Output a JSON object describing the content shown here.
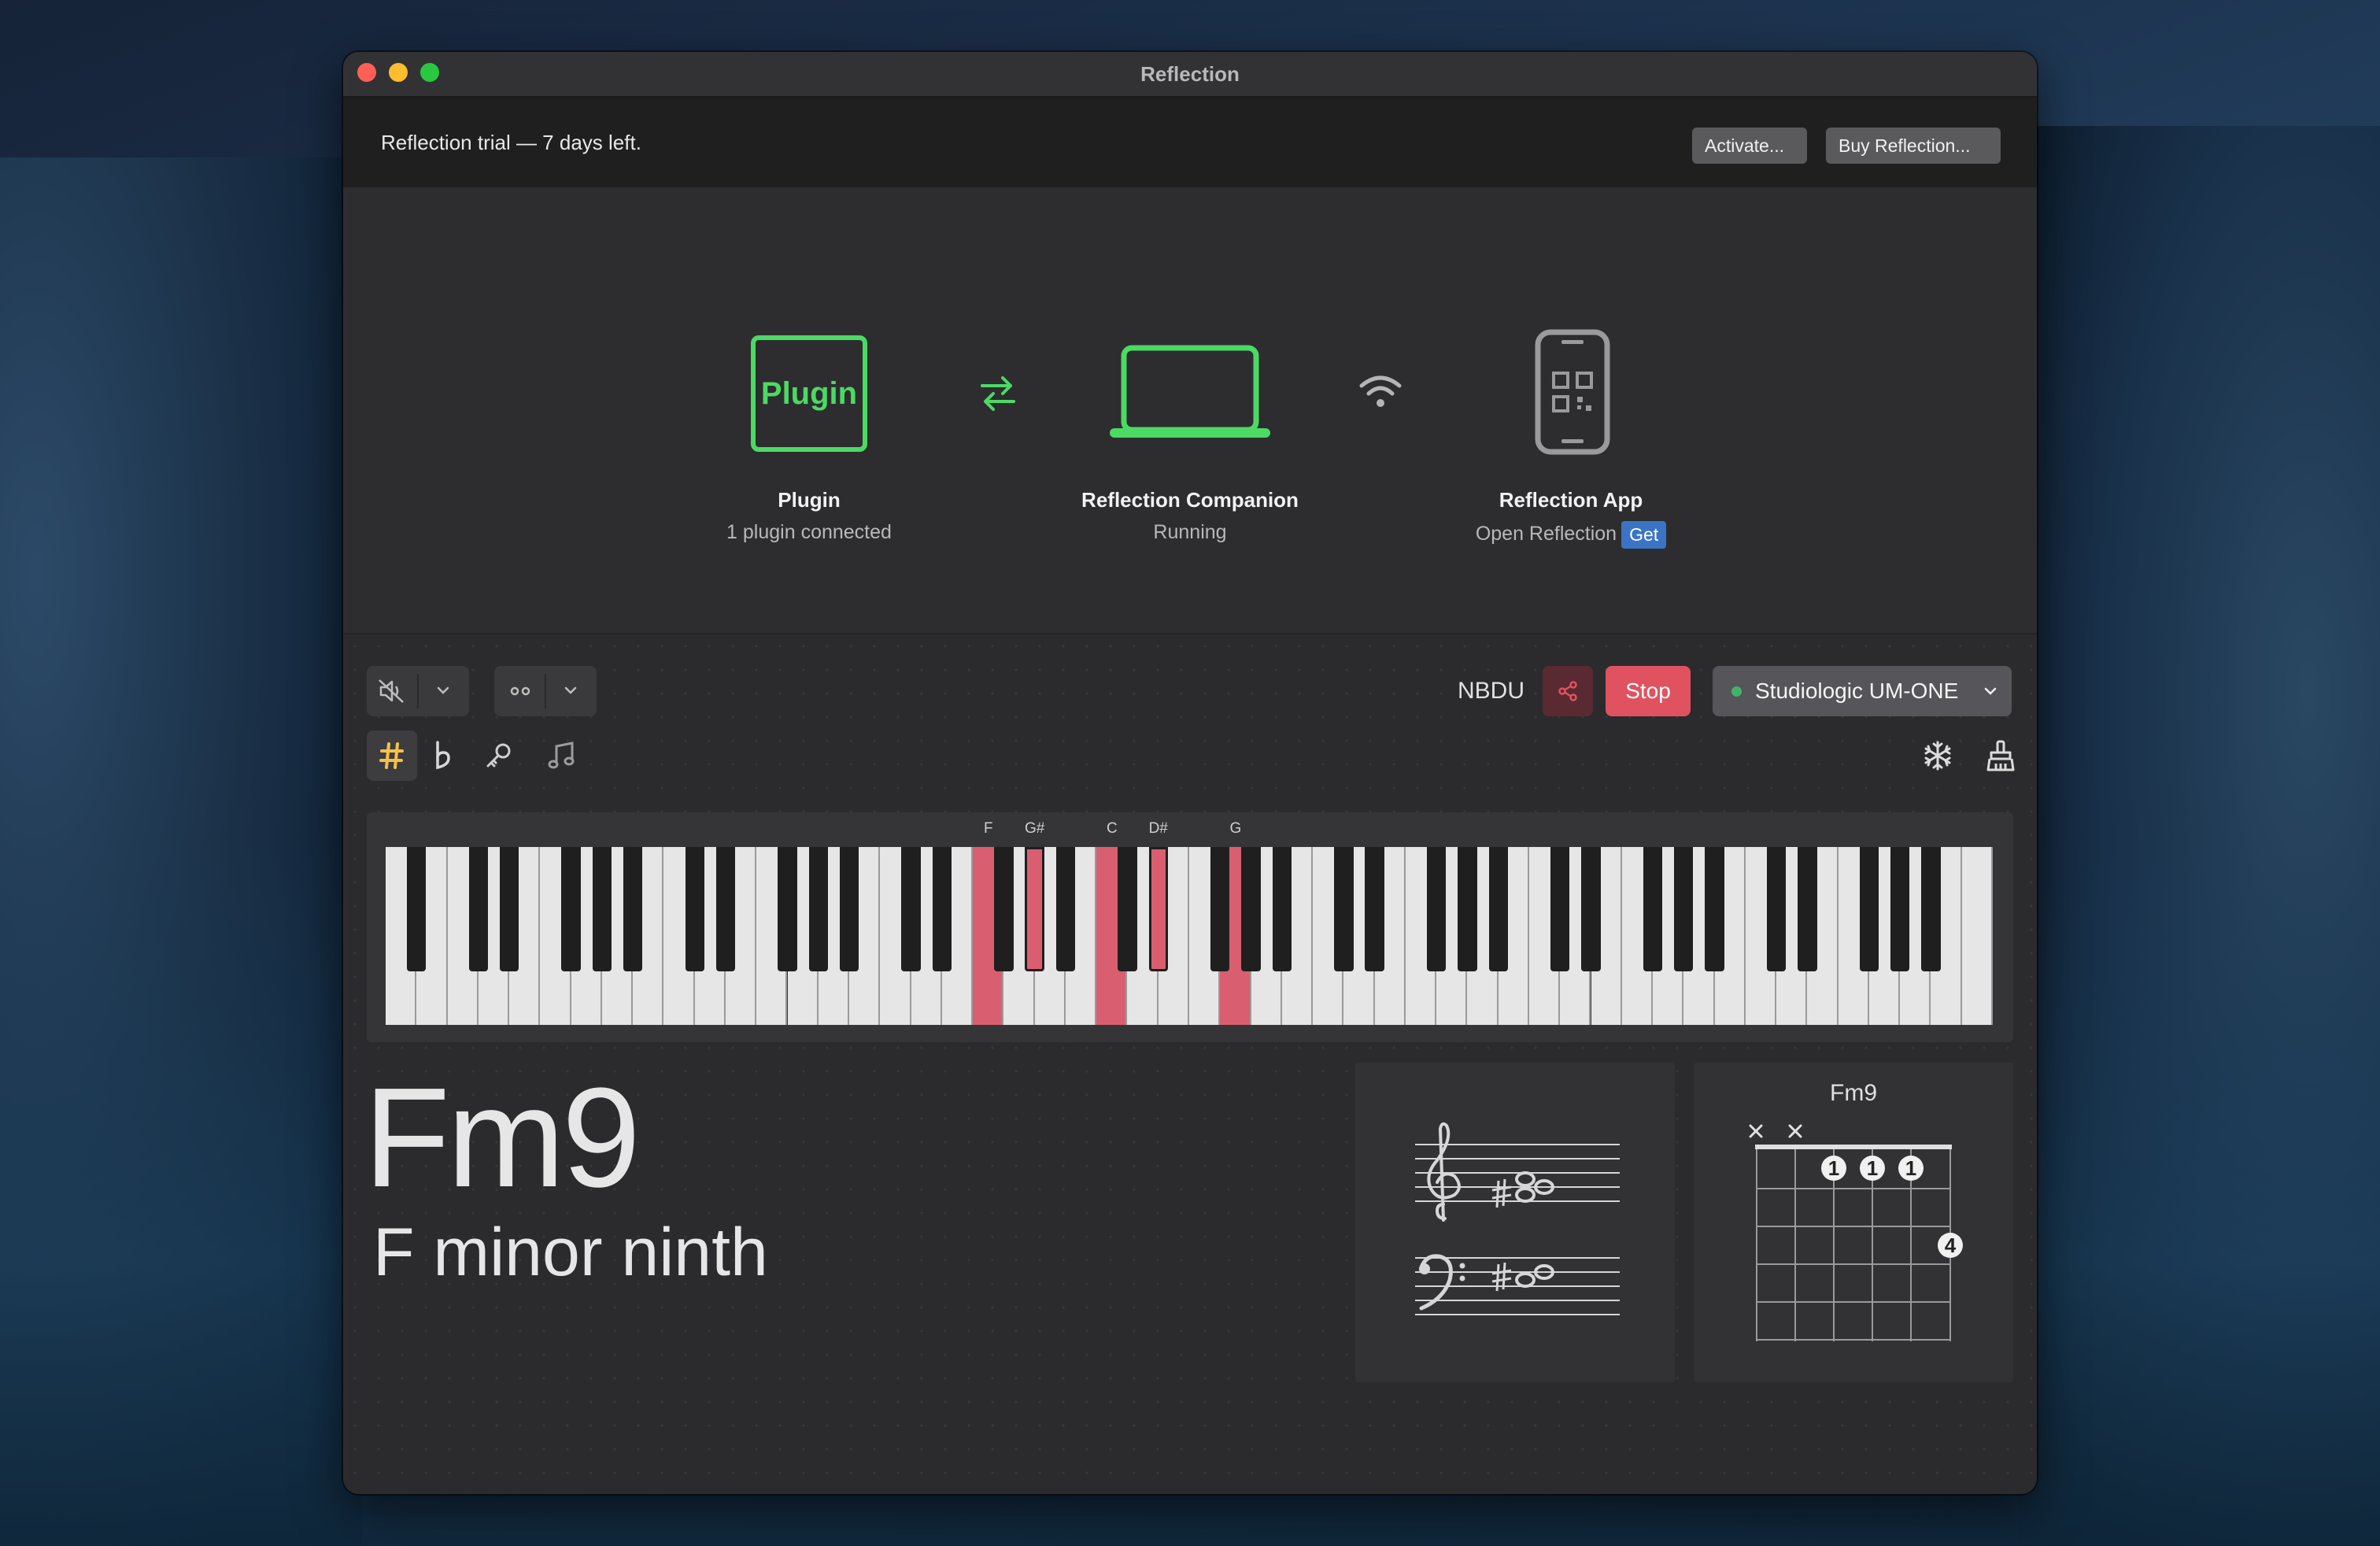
{
  "window": {
    "title": "Reflection"
  },
  "trial": {
    "message": "Reflection trial — 7 days left.",
    "activate_label": "Activate...",
    "buy_label": "Buy Reflection..."
  },
  "status": {
    "plugin": {
      "icon_text": "Plugin",
      "title": "Plugin",
      "subtitle": "1 plugin connected"
    },
    "companion": {
      "title": "Reflection Companion",
      "subtitle": "Running"
    },
    "app": {
      "title": "Reflection App",
      "subtitle": "Open Reflection",
      "get_label": "Get"
    },
    "accent_green": "#4cd964"
  },
  "toolbar": {
    "session_code": "NBDU",
    "stop_label": "Stop",
    "midi_device": "Studiologic UM-ONE",
    "device_status_color": "#43b36a",
    "stop_color": "#e0525f"
  },
  "notation_tools": [
    "sharp-icon",
    "flat-icon",
    "key-icon",
    "music-note-icon"
  ],
  "keyboard": {
    "note_labels": [
      "F",
      "G#",
      "C",
      "D#",
      "G"
    ],
    "highlight_color": "#d95f70"
  },
  "chord": {
    "symbol": "Fm9",
    "name": "F minor ninth",
    "guitar_title": "Fm9",
    "guitar_fingers": [
      "1",
      "1",
      "1",
      "4"
    ]
  }
}
